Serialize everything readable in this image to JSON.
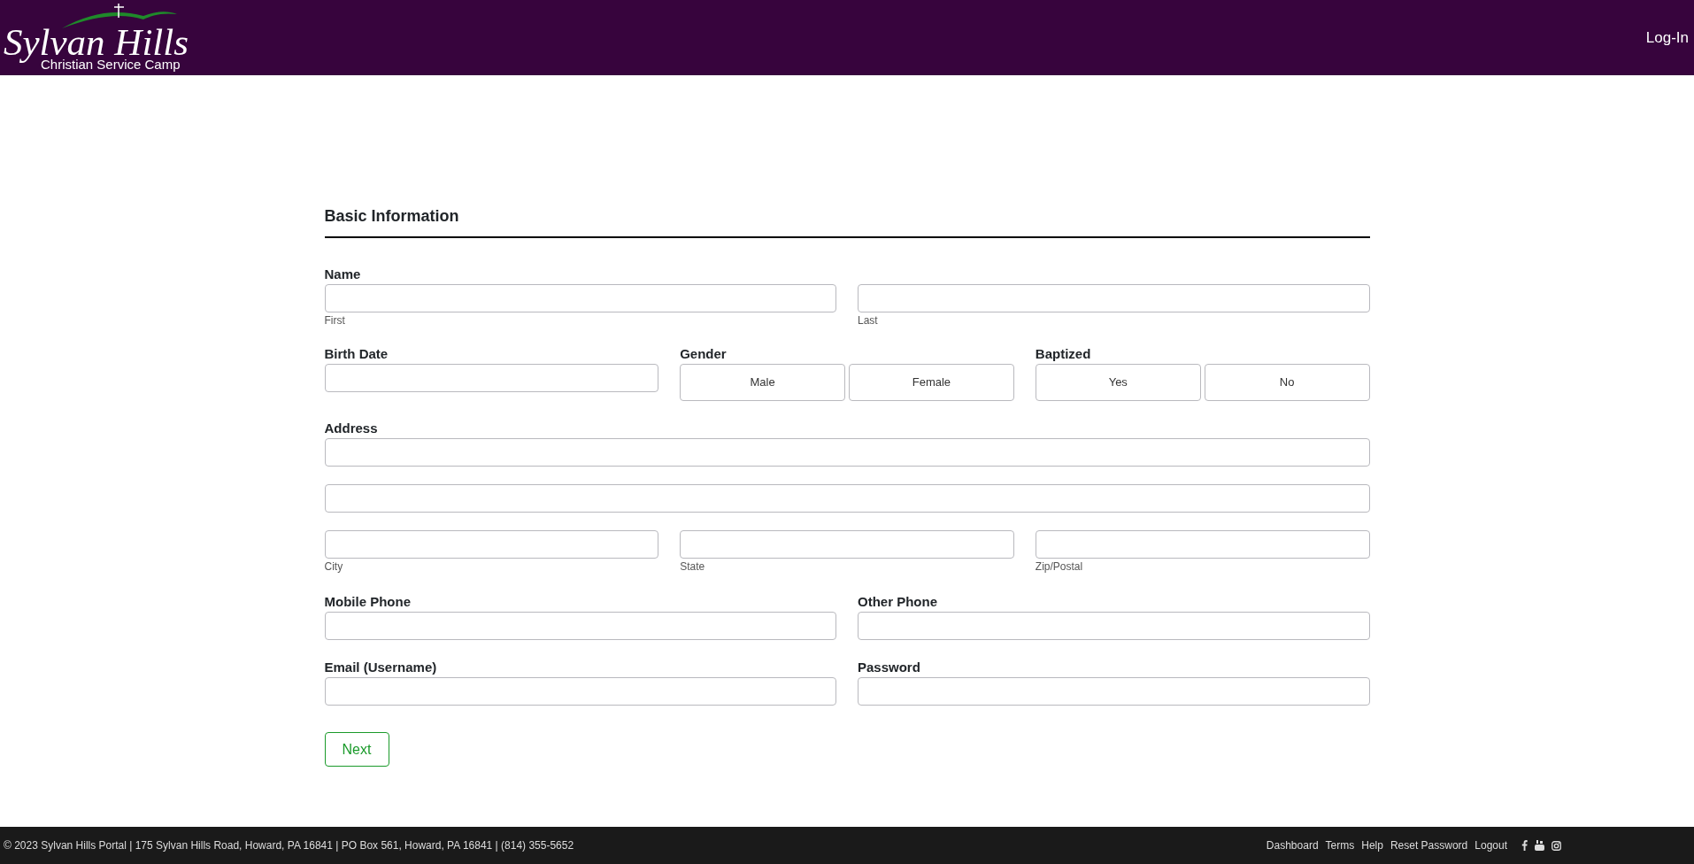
{
  "header": {
    "logo": {
      "title": "Sylvan Hills",
      "subtitle": "Christian Service Camp"
    },
    "login": "Log-In"
  },
  "form": {
    "heading": "Basic Information",
    "sections": [
      {
        "rows": [
          [
            {
              "label": "Name",
              "kind": "input",
              "caption": "First"
            },
            {
              "kind": "input",
              "caption": "Last"
            }
          ],
          [
            {
              "label": "Birth Date",
              "kind": "input"
            },
            {
              "label": "Gender",
              "kind": "choices",
              "options": [
                {
                  "label": "Male",
                  "selected": false
                },
                {
                  "label": "Female",
                  "selected": false
                }
              ]
            },
            {
              "label": "Baptized",
              "kind": "choices",
              "options": [
                {
                  "label": "Yes",
                  "selected": false
                },
                {
                  "label": "No",
                  "selected": false
                }
              ]
            }
          ],
          [
            {
              "label": "Address",
              "kind": "input"
            }
          ],
          [
            {
              "kind": "input"
            }
          ],
          [
            {
              "kind": "input",
              "caption": "City"
            },
            {
              "kind": "input",
              "caption": "State"
            },
            {
              "kind": "input",
              "caption": "Zip/Postal"
            }
          ]
        ]
      },
      {
        "rows": [
          [
            {
              "label": "Mobile Phone",
              "kind": "input"
            },
            {
              "label": "Other Phone",
              "kind": "input"
            }
          ],
          [
            {
              "label": "Email (Username)",
              "kind": "input"
            },
            {
              "label": "Password",
              "kind": "input"
            }
          ]
        ]
      }
    ],
    "submit": "Next"
  },
  "footer": {
    "text": "© 2023 Sylvan Hills Portal | 175 Sylvan Hills Road, Howard, PA 16841 | PO Box 561, Howard, PA 16841 | (814) 355-5652",
    "links": [
      "Dashboard",
      "Terms",
      "Help",
      "Reset Password",
      "Logout"
    ]
  }
}
